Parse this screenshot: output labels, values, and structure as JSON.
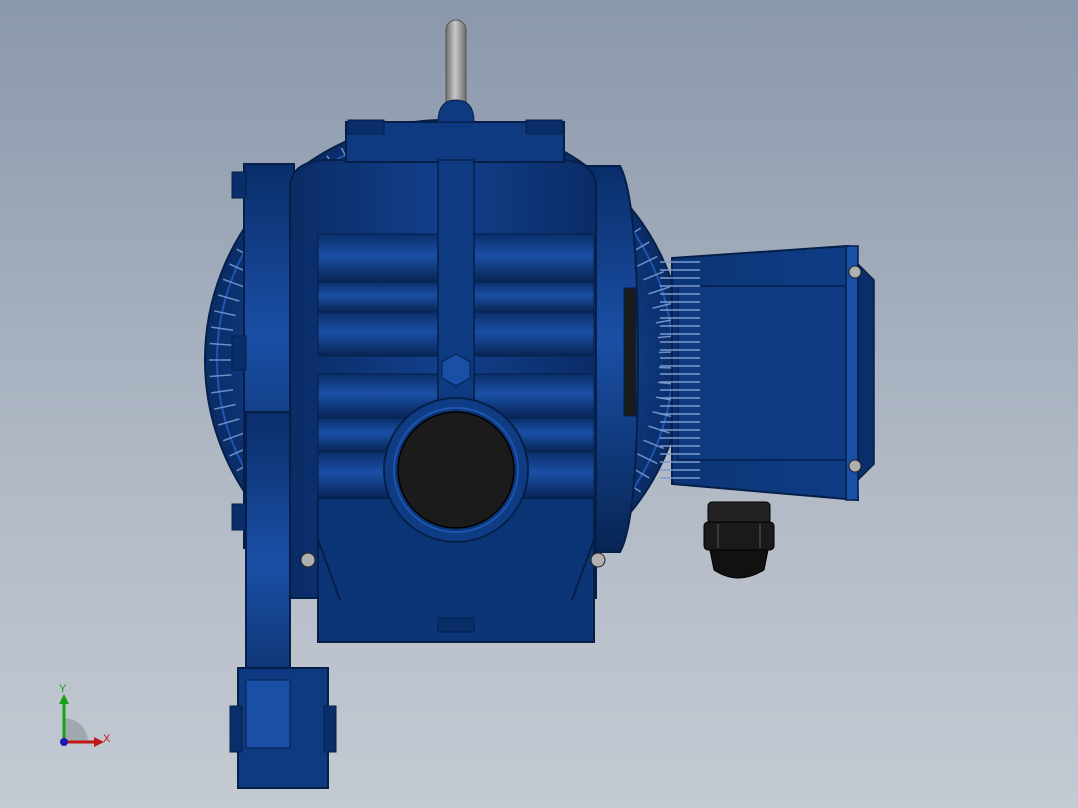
{
  "viewport": {
    "background_top": "#8a98ab",
    "background_bottom": "#c4cad2"
  },
  "model": {
    "part": "motorized-gear-actuator",
    "body_color": "#0a3170",
    "body_light": "#1e55b0",
    "body_dark": "#06224f",
    "bore_color": "#1b1b1b",
    "handle_color": "#9a9a9a",
    "gland_color": "#1a1a1a"
  },
  "triad": {
    "x_label": "X",
    "y_label": "Y",
    "x_color": "#c01818",
    "y_color": "#18a018",
    "z_color": "#1a1ab0"
  }
}
